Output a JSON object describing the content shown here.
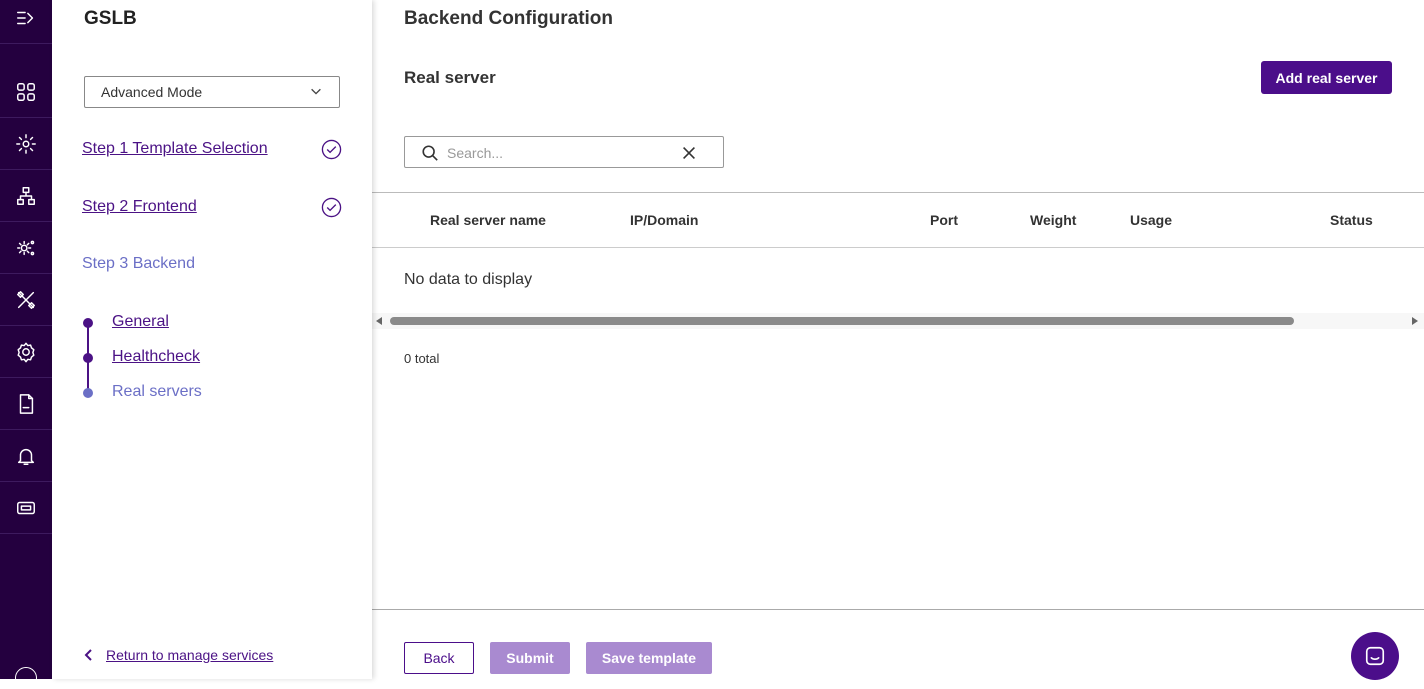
{
  "rail": {
    "icons": [
      "expand-menu-icon",
      "dashboard-icon",
      "services-gear-icon",
      "topology-icon",
      "config-gear-icon",
      "tools-icon",
      "settings-icon",
      "log-file-icon",
      "notifications-bell-icon",
      "ticket-icon",
      "info-icon"
    ]
  },
  "panel": {
    "title": "GSLB",
    "mode_select": "Advanced Mode",
    "steps": [
      {
        "label": "Step 1 Template Selection",
        "completed": true
      },
      {
        "label": "Step 2 Frontend",
        "completed": true
      },
      {
        "label": "Step 3 Backend",
        "completed": false,
        "active": true
      }
    ],
    "substeps": [
      {
        "label": "General"
      },
      {
        "label": "Healthcheck"
      },
      {
        "label": "Real servers",
        "active": true
      }
    ],
    "return_label": "Return to manage services"
  },
  "main": {
    "title": "Backend Configuration",
    "section_title": "Real server",
    "add_button": "Add real server",
    "search_placeholder": "Search...",
    "columns": [
      "Real server name",
      "IP/Domain",
      "Port",
      "Weight",
      "Usage",
      "Status"
    ],
    "empty_message": "No data to display",
    "total": "0 total",
    "buttons": {
      "back": "Back",
      "submit": "Submit",
      "save_template": "Save template"
    }
  },
  "colors": {
    "rail_bg": "#24003f",
    "primary": "#4b0e8a",
    "active_step": "#6b6fc6",
    "disabled_button": "#a98ad0"
  }
}
